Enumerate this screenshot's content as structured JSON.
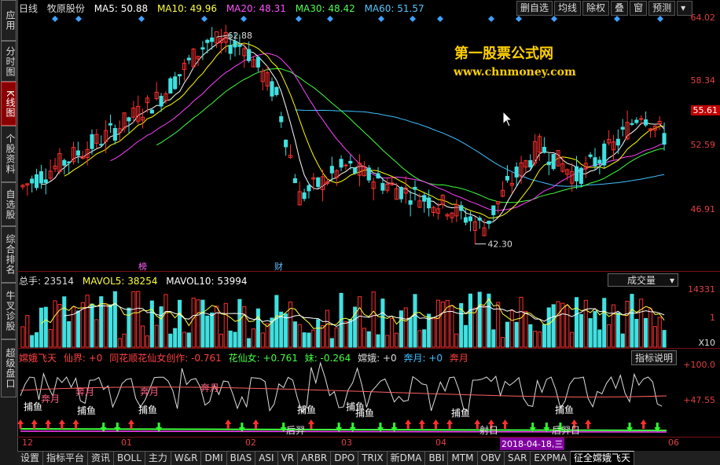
{
  "sidebar": [
    {
      "label": "应用",
      "active": false
    },
    {
      "label": "分时图",
      "active": false
    },
    {
      "label": "K线图",
      "active": true
    },
    {
      "label": "个股资料",
      "active": false
    },
    {
      "label": "自选股",
      "active": false
    },
    {
      "label": "综合排名",
      "active": false
    },
    {
      "label": "牛叉诊股",
      "active": false
    },
    {
      "label": "超级盘口",
      "active": false
    }
  ],
  "header": {
    "period": "日线",
    "stock": "牧原股份",
    "ma5": "MA5: 50.88",
    "ma10": "MA10: 49.96",
    "ma20": "MA20: 48.31",
    "ma30": "MA30: 48.42",
    "ma60": "MA60: 51.57",
    "buttons": [
      "删自选",
      "均线",
      "除权",
      "叠",
      "窗",
      "预测"
    ],
    "colors": {
      "ma5": "#ffffff",
      "ma10": "#ffff00",
      "ma20": "#ff40ff",
      "ma30": "#40ff40",
      "ma60": "#40c0ff",
      "up": "#ff3030",
      "down": "#40e0e0"
    }
  },
  "price_axis": {
    "labels": [
      "64.02",
      "58.34",
      "52.59",
      "46.91"
    ],
    "tag": "55.61"
  },
  "annotations": {
    "high": "62.88",
    "low": "42.30",
    "bang": "榜",
    "cai": "财"
  },
  "watermark": {
    "line1": "第一股票公式网",
    "line2": "www.chnmoney.com"
  },
  "volume": {
    "total": "总手: 23514",
    "mavol5": "MAVOL5: 38254",
    "mavol10": "MAVOL10: 53994",
    "dropdown": "成交量",
    "axis_top": "14331",
    "axis_mid": "1",
    "unit": "X10"
  },
  "indicator": {
    "name": "嫦娥飞天",
    "items": [
      "仙界: +0",
      "同花顺花仙女创作: -0.761",
      "花仙女: +0.761",
      "妹: -0.264",
      "嫦娥: +0",
      "奔月: +0",
      "奔月"
    ],
    "button": "指标说明",
    "axis_top": "+100.0",
    "axis_mid": "+47.55",
    "labels": [
      "捕鱼",
      "捕鱼",
      "捕鱼",
      "捕鱼",
      "捕鱼",
      "捕鱼",
      "捕鱼",
      "捕鱼",
      "奔月",
      "奔月",
      "奔月",
      "奔月",
      "后羿",
      "射日",
      "后羿日"
    ]
  },
  "dates": {
    "labels": [
      "12",
      "01",
      "02",
      "03",
      "04",
      "06"
    ],
    "cursor": "2018-04-18,三"
  },
  "bottom_tabs": [
    "设置",
    "指标平台",
    "资讯",
    "BOLL",
    "主力",
    "W&R",
    "DMI",
    "BIAS",
    "ASI",
    "VR",
    "ARBR",
    "DPO",
    "TRIX",
    "新DMA",
    "BBI",
    "MTM",
    "OBV",
    "SAR",
    "EXPMA",
    "征全嫦娥飞天"
  ],
  "active_tab": "征全嫦娥飞天"
}
